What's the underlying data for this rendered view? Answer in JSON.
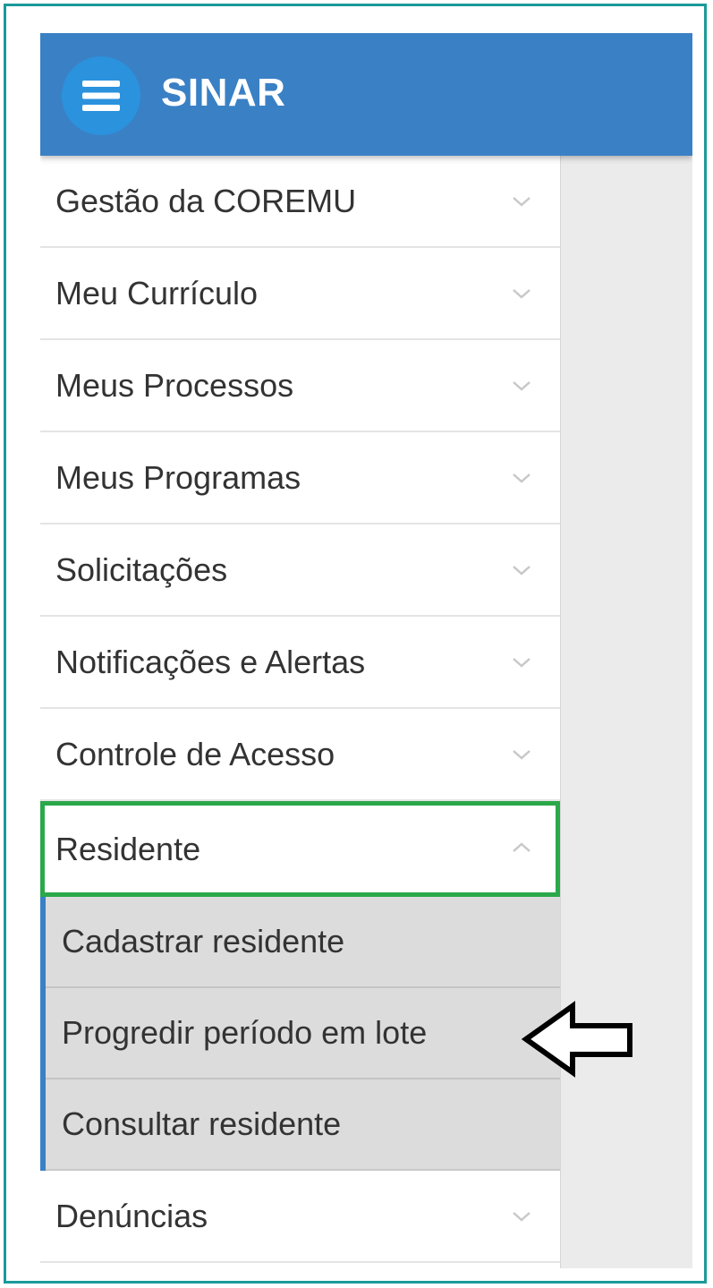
{
  "header": {
    "title": "SINAR",
    "menu_icon": "hamburger-icon",
    "color": "#3a80c5"
  },
  "sidebar": {
    "items": [
      {
        "label": "Gestão da COREMU",
        "icon": "chevron-down-icon"
      },
      {
        "label": "Meu Currículo",
        "icon": "chevron-down-icon"
      },
      {
        "label": "Meus Processos",
        "icon": "chevron-down-icon"
      },
      {
        "label": "Meus Programas",
        "icon": "chevron-down-icon"
      },
      {
        "label": "Solicitações",
        "icon": "chevron-down-icon"
      },
      {
        "label": "Notificações e Alertas",
        "icon": "chevron-down-icon"
      },
      {
        "label": "Controle de Acesso",
        "icon": "chevron-down-icon"
      },
      {
        "label": "Residente",
        "icon": "chevron-up-icon",
        "expanded": true,
        "highlight_color": "#2aa84a"
      },
      {
        "label": "Denúncias",
        "icon": "chevron-down-icon"
      }
    ],
    "residente_submenu": [
      {
        "label": "Cadastrar residente"
      },
      {
        "label": "Progredir período em lote",
        "annotated": true
      },
      {
        "label": "Consultar residente"
      }
    ]
  },
  "annotation": {
    "icon": "left-arrow-pointer-icon"
  }
}
